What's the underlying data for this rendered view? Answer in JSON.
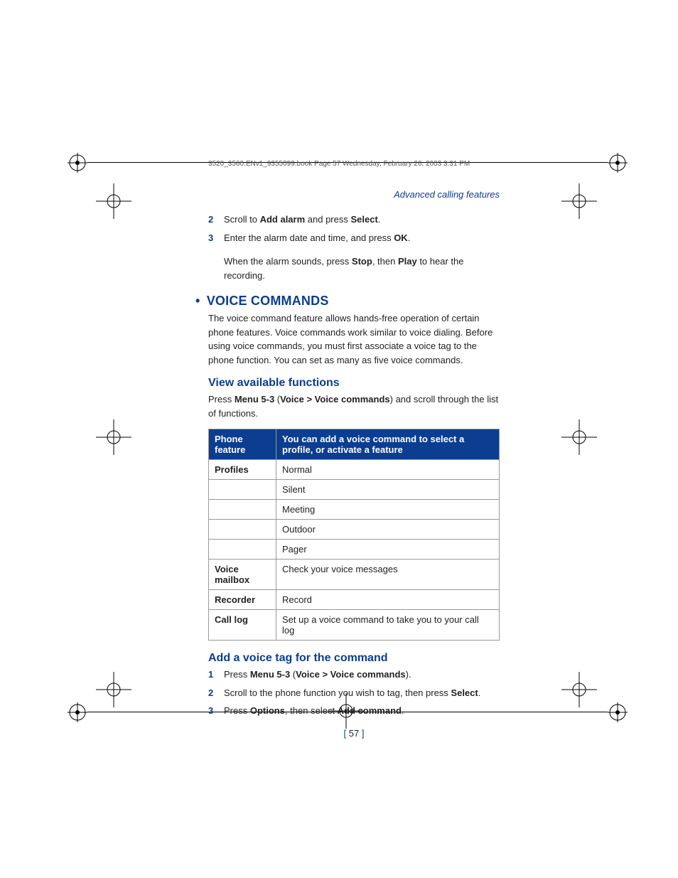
{
  "slug": "3520_3560.ENv1_9355099.book  Page 57  Wednesday, February 26, 2003  3:31 PM",
  "section_label": "Advanced calling features",
  "steps_top": [
    {
      "n": "2",
      "pre": "Scroll to ",
      "b1": "Add alarm",
      "mid": " and press ",
      "b2": "Select",
      "post": "."
    },
    {
      "n": "3",
      "pre": "Enter the alarm date and time, and press ",
      "b1": "OK",
      "mid": "",
      "b2": "",
      "post": "."
    }
  ],
  "sub_line": {
    "pre": "When the alarm sounds, press ",
    "b1": "Stop",
    "mid": ", then ",
    "b2": "Play",
    "post": " to hear the recording."
  },
  "h1": "VOICE COMMANDS",
  "body1": "The voice command feature allows hands-free operation of certain phone features. Voice commands work similar to voice dialing. Before using voice commands, you must first associate a voice tag to the phone function. You can set as many as five voice commands.",
  "h2a": "View available functions",
  "view_line": {
    "pre": "Press ",
    "b1": "Menu 5-3",
    "mid": " (",
    "b2": "Voice > Voice commands",
    "post": ") and scroll through the list of functions."
  },
  "table": {
    "th1": "Phone feature",
    "th2": "You can add a voice command to select a profile, or activate a feature",
    "rows": [
      {
        "f": "Profiles",
        "v": "Normal"
      },
      {
        "f": "",
        "v": "Silent"
      },
      {
        "f": "",
        "v": "Meeting"
      },
      {
        "f": "",
        "v": "Outdoor"
      },
      {
        "f": "",
        "v": "Pager"
      },
      {
        "f": "Voice mailbox",
        "v": "Check your voice messages"
      },
      {
        "f": "Recorder",
        "v": "Record"
      },
      {
        "f": "Call log",
        "v": "Set up a voice command to take you to your call log"
      }
    ]
  },
  "h2b": "Add a voice tag for the command",
  "steps_bottom": [
    {
      "n": "1",
      "pre": "Press ",
      "b1": "Menu 5-3",
      "mid": " (",
      "b2": "Voice > Voice commands",
      "post": ")."
    },
    {
      "n": "2",
      "pre": "Scroll to the phone function you wish to tag, then press ",
      "b1": "Select",
      "mid": "",
      "b2": "",
      "post": "."
    },
    {
      "n": "3",
      "pre": "Press ",
      "b1": "Options",
      "mid": ", then select ",
      "b2": "Add command",
      "post": "."
    }
  ],
  "pagenum": "57"
}
